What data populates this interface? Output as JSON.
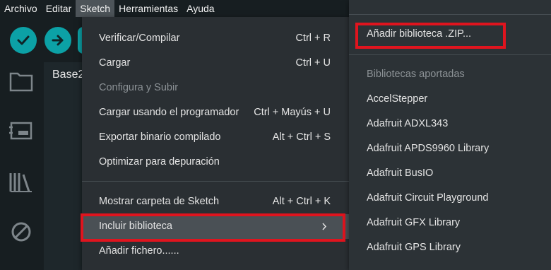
{
  "menubar": {
    "items": [
      {
        "label": "Archivo"
      },
      {
        "label": "Editar"
      },
      {
        "label": "Sketch"
      },
      {
        "label": "Herramientas"
      },
      {
        "label": "Ayuda"
      }
    ]
  },
  "editor": {
    "tab_title": "Base2"
  },
  "sketch_menu": {
    "items": [
      {
        "label": "Verificar/Compilar",
        "shortcut": "Ctrl + R"
      },
      {
        "label": "Cargar",
        "shortcut": "Ctrl + U"
      },
      {
        "label": "Configura y Subir",
        "shortcut": ""
      },
      {
        "label": "Cargar usando el programador",
        "shortcut": "Ctrl + Mayús + U"
      },
      {
        "label": "Exportar binario compilado",
        "shortcut": "Alt + Ctrl + S"
      },
      {
        "label": "Optimizar para depuración",
        "shortcut": ""
      },
      {
        "label": "Mostrar carpeta de Sketch",
        "shortcut": "Alt + Ctrl + K"
      },
      {
        "label": "Incluir biblioteca",
        "shortcut": ""
      },
      {
        "label": "Añadir fichero......",
        "shortcut": ""
      }
    ]
  },
  "library_menu": {
    "add_zip": "Añadir biblioteca .ZIP...",
    "section_header": "Bibliotecas aportadas",
    "libraries": [
      "AccelStepper",
      "Adafruit ADXL343",
      "Adafruit APDS9960 Library",
      "Adafruit BusIO",
      "Adafruit Circuit Playground",
      "Adafruit GFX Library",
      "Adafruit GPS Library"
    ]
  },
  "colors": {
    "accent": "#0ca1a6",
    "highlight_border": "#e0141e",
    "menu_bg": "#2a2f33"
  }
}
